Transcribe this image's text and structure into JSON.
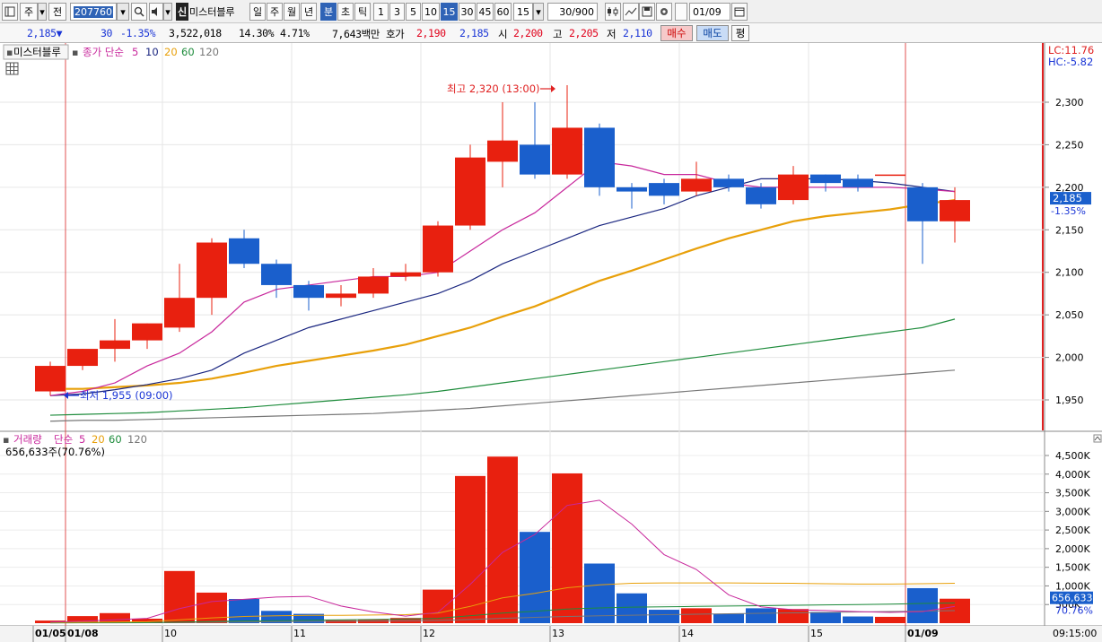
{
  "toolbar": {
    "tab_stock": "주",
    "tab_prev": "전",
    "stock_code": "207760",
    "stock_name": "미스터블루",
    "badge": "신",
    "periods": [
      "일",
      "주",
      "월",
      "년",
      "분",
      "초",
      "틱"
    ],
    "intervals": [
      "1",
      "3",
      "5",
      "10",
      "15",
      "30",
      "45",
      "60"
    ],
    "interval_value": "15",
    "count_value": "30/900",
    "date_value": "01/09"
  },
  "infobar": {
    "price": "2,185",
    "change": "30",
    "change_pct": "-1.35%",
    "volume": "3,522,018",
    "vol_ratio": "14.30%",
    "rate2": "4.71%",
    "amount": "7,643백만",
    "quote_label": "호가",
    "ask": "2,190",
    "bid": "2,185",
    "open_label": "시",
    "open": "2,200",
    "high_label": "고",
    "high": "2,205",
    "low_label": "저",
    "low": "2,110",
    "buy_label": "매수",
    "sell_label": "매도",
    "avg_label": "평"
  },
  "price_panel": {
    "stock_label": "미스터블루",
    "legend_prefix": "종가 단순",
    "ma_labels": [
      "5",
      "10",
      "20",
      "60",
      "120"
    ],
    "ma_colors": [
      "#c8289c",
      "#1a2680",
      "#e8a00a",
      "#1e8c3c",
      "#777777"
    ],
    "lc": "LC:11.76",
    "hc": "HC:-5.82",
    "high_note": "최고 2,320 (13:00)",
    "low_note": "최저 1,955 (09:00)",
    "last_price": "2,185",
    "last_pct": "-1.35%"
  },
  "volume_panel": {
    "legend_prefix": "거래량",
    "legend_type": "단순",
    "ma_labels": [
      "5",
      "20",
      "60",
      "120"
    ],
    "ma_colors": [
      "#c8289c",
      "#e8a00a",
      "#1e8c3c",
      "#777777"
    ],
    "summary": "656,633주(70.76%)",
    "last_volume": "656,633",
    "last_pct": "70.76%"
  },
  "x_labels": [
    "01/05",
    "01/08",
    "10",
    "11",
    "12",
    "13",
    "14",
    "15",
    "01/09",
    "09:15:00"
  ],
  "chart_data": [
    {
      "type": "candlestick",
      "y_ticks": [
        1950,
        2000,
        2050,
        2100,
        2150,
        2200,
        2250,
        2300
      ],
      "ylim": [
        1900,
        2340
      ],
      "candles": [
        {
          "o": 1960,
          "h": 1995,
          "l": 1955,
          "c": 1990
        },
        {
          "o": 1990,
          "h": 2010,
          "l": 1985,
          "c": 2010
        },
        {
          "o": 2010,
          "h": 2045,
          "l": 1995,
          "c": 2020
        },
        {
          "o": 2020,
          "h": 2040,
          "l": 2010,
          "c": 2040
        },
        {
          "o": 2035,
          "h": 2110,
          "l": 2030,
          "c": 2070
        },
        {
          "o": 2070,
          "h": 2140,
          "l": 2050,
          "c": 2135
        },
        {
          "o": 2140,
          "h": 2150,
          "l": 2105,
          "c": 2110
        },
        {
          "o": 2110,
          "h": 2115,
          "l": 2070,
          "c": 2085
        },
        {
          "o": 2085,
          "h": 2090,
          "l": 2055,
          "c": 2070
        },
        {
          "o": 2070,
          "h": 2085,
          "l": 2060,
          "c": 2075
        },
        {
          "o": 2075,
          "h": 2105,
          "l": 2070,
          "c": 2095
        },
        {
          "o": 2095,
          "h": 2110,
          "l": 2090,
          "c": 2100
        },
        {
          "o": 2100,
          "h": 2160,
          "l": 2095,
          "c": 2155
        },
        {
          "o": 2155,
          "h": 2250,
          "l": 2150,
          "c": 2235
        },
        {
          "o": 2230,
          "h": 2300,
          "l": 2200,
          "c": 2255
        },
        {
          "o": 2250,
          "h": 2300,
          "l": 2210,
          "c": 2215
        },
        {
          "o": 2215,
          "h": 2320,
          "l": 2210,
          "c": 2270
        },
        {
          "o": 2270,
          "h": 2275,
          "l": 2190,
          "c": 2200
        },
        {
          "o": 2200,
          "h": 2205,
          "l": 2175,
          "c": 2195
        },
        {
          "o": 2205,
          "h": 2210,
          "l": 2180,
          "c": 2190
        },
        {
          "o": 2195,
          "h": 2230,
          "l": 2190,
          "c": 2210
        },
        {
          "o": 2210,
          "h": 2215,
          "l": 2195,
          "c": 2200
        },
        {
          "o": 2200,
          "h": 2205,
          "l": 2175,
          "c": 2180
        },
        {
          "o": 2185,
          "h": 2225,
          "l": 2180,
          "c": 2215
        },
        {
          "o": 2215,
          "h": 2215,
          "l": 2195,
          "c": 2205
        },
        {
          "o": 2210,
          "h": 2215,
          "l": 2195,
          "c": 2200
        },
        {
          "o": 2215,
          "h": 2215,
          "l": 2215,
          "c": 2215
        },
        {
          "o": 2200,
          "h": 2205,
          "l": 2110,
          "c": 2160
        },
        {
          "o": 2160,
          "h": 2200,
          "l": 2135,
          "c": 2185
        }
      ],
      "ma5": [
        1955,
        1960,
        1970,
        1990,
        2005,
        2030,
        2065,
        2080,
        2085,
        2090,
        2095,
        2095,
        2100,
        2125,
        2150,
        2170,
        2200,
        2230,
        2225,
        2215,
        2215,
        2205,
        2200,
        2200,
        2200,
        2200,
        2200,
        2198,
        2195
      ],
      "ma10": [
        1955,
        1957,
        1962,
        1968,
        1975,
        1985,
        2005,
        2020,
        2035,
        2045,
        2055,
        2065,
        2075,
        2090,
        2110,
        2125,
        2140,
        2155,
        2165,
        2175,
        2190,
        2200,
        2210,
        2210,
        2210,
        2208,
        2205,
        2200,
        2195
      ],
      "ma20": [
        1963,
        1963,
        1965,
        1967,
        1970,
        1975,
        1982,
        1990,
        1996,
        2002,
        2008,
        2015,
        2025,
        2035,
        2048,
        2060,
        2075,
        2090,
        2102,
        2115,
        2128,
        2140,
        2150,
        2160,
        2166,
        2170,
        2174,
        2180,
        2185
      ],
      "ma60": [
        1932,
        1933,
        1934,
        1935,
        1937,
        1939,
        1941,
        1944,
        1947,
        1950,
        1953,
        1956,
        1960,
        1965,
        1970,
        1975,
        1980,
        1985,
        1990,
        1995,
        2000,
        2005,
        2010,
        2015,
        2020,
        2025,
        2030,
        2035,
        2045
      ],
      "ma120": [
        1925,
        1926,
        1926,
        1927,
        1928,
        1929,
        1930,
        1931,
        1932,
        1933,
        1934,
        1936,
        1938,
        1940,
        1943,
        1946,
        1949,
        1952,
        1955,
        1958,
        1961,
        1964,
        1967,
        1970,
        1973,
        1976,
        1979,
        1982,
        1985
      ]
    },
    {
      "type": "bar",
      "name": "volume",
      "y_ticks": [
        500000,
        1000000,
        1500000,
        2000000,
        2500000,
        3000000,
        3500000,
        4000000,
        4500000
      ],
      "y_tick_labels": [
        "500K",
        "1,000K",
        "1,500K",
        "2,000K",
        "2,500K",
        "3,000K",
        "3,500K",
        "4,000K",
        "4,500K"
      ],
      "ylim": [
        0,
        4800000
      ],
      "values": [
        70000,
        190000,
        270000,
        120000,
        1400000,
        820000,
        650000,
        330000,
        250000,
        80000,
        100000,
        140000,
        900000,
        3950000,
        4470000,
        2450000,
        4020000,
        1600000,
        800000,
        360000,
        400000,
        250000,
        400000,
        380000,
        300000,
        180000,
        170000,
        940000,
        656633
      ],
      "ma5": [
        30000,
        50000,
        90000,
        130000,
        390000,
        580000,
        640000,
        700000,
        720000,
        460000,
        300000,
        190000,
        290000,
        1040000,
        1900000,
        2380000,
        3160000,
        3300000,
        2660000,
        1840000,
        1440000,
        760000,
        440000,
        360000,
        340000,
        310000,
        290000,
        310000,
        450000
      ],
      "ma20": [
        20000,
        25000,
        30000,
        40000,
        90000,
        140000,
        180000,
        200000,
        210000,
        210000,
        220000,
        230000,
        270000,
        450000,
        680000,
        800000,
        950000,
        1030000,
        1070000,
        1080000,
        1080000,
        1080000,
        1075000,
        1070000,
        1060000,
        1050000,
        1050000,
        1060000,
        1070000
      ],
      "ma60": [
        10000,
        12000,
        14000,
        16000,
        30000,
        45000,
        60000,
        70000,
        80000,
        90000,
        100000,
        110000,
        130000,
        200000,
        270000,
        320000,
        380000,
        410000,
        430000,
        440000,
        450000,
        460000,
        470000,
        480000,
        490000,
        500000,
        510000,
        530000,
        540000
      ],
      "ma120": [
        8000,
        9000,
        10000,
        11000,
        18000,
        25000,
        32000,
        38000,
        44000,
        50000,
        56000,
        62000,
        72000,
        100000,
        130000,
        155000,
        180000,
        200000,
        215000,
        228000,
        240000,
        252000,
        264000,
        276000,
        288000,
        300000,
        312000,
        324000,
        336000
      ]
    }
  ]
}
